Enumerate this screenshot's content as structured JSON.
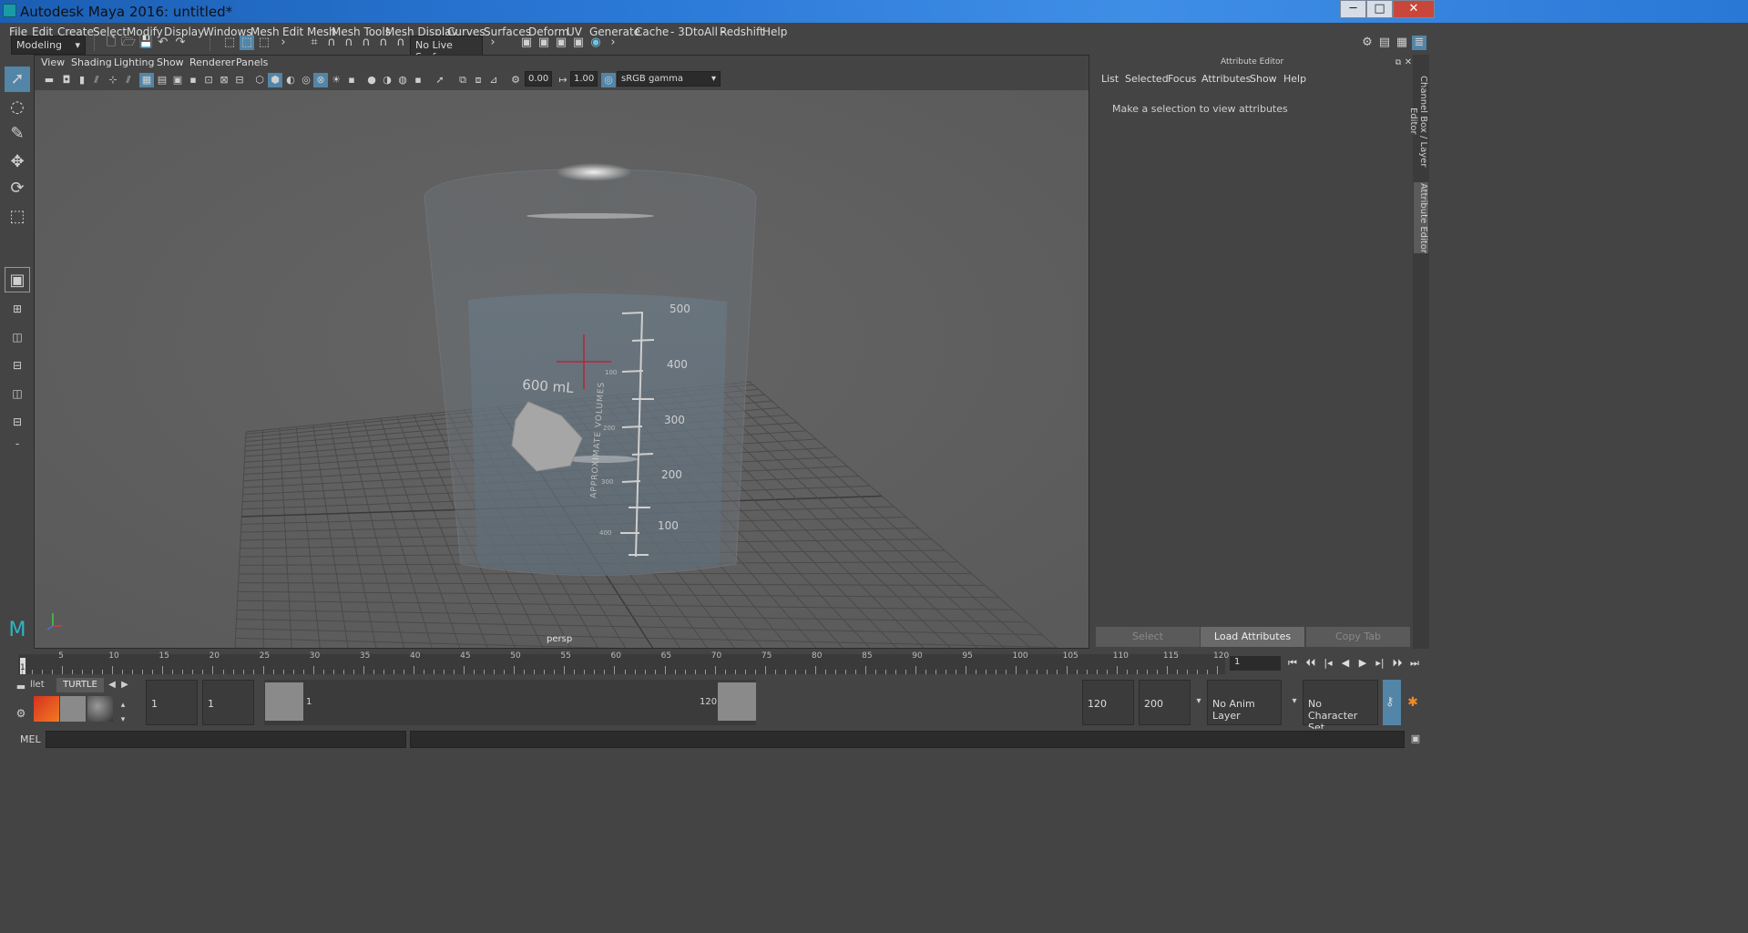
{
  "window": {
    "title": "Autodesk Maya 2016: untitled*",
    "minimize": "─",
    "maximize": "□",
    "close": "✕"
  },
  "menu": [
    "File",
    "Edit",
    "Create",
    "Select",
    "Modify",
    "Display",
    "Windows",
    "Mesh",
    "Edit Mesh",
    "Mesh Tools",
    "Mesh Display",
    "Curves",
    "Surfaces",
    "Deform",
    "UV",
    "Generate",
    "Cache",
    "- 3DtoAll -",
    "Redshift",
    "Help"
  ],
  "shelf": {
    "mode": "Modeling",
    "live_surface": "No Live Surface"
  },
  "viewport": {
    "menu": [
      "View",
      "Shading",
      "Lighting",
      "Show",
      "Renderer",
      "Panels"
    ],
    "exposure": "0.00",
    "gamma": "1.00",
    "color_space": "sRGB gamma",
    "camera_label": "persp",
    "beaker": {
      "capacity": "600 mL",
      "side_text": "APPROXIMATE VOLUMES",
      "marks_big": [
        "500",
        "400",
        "300",
        "200",
        "100"
      ],
      "marks_small": [
        "100",
        "200",
        "300",
        "400"
      ]
    }
  },
  "attribute_editor": {
    "title": "Attribute Editor",
    "menu": [
      "List",
      "Selected",
      "Focus",
      "Attributes",
      "Show",
      "Help"
    ],
    "message": "Make a selection to view attributes",
    "buttons": {
      "select": "Select",
      "load": "Load Attributes",
      "copy": "Copy Tab"
    }
  },
  "side_tabs": {
    "channel_box": "Channel Box / Layer Editor",
    "attribute_editor": "Attribute Editor"
  },
  "timeline": {
    "labels": [
      "5",
      "10",
      "15",
      "20",
      "25",
      "30",
      "35",
      "40",
      "45",
      "50",
      "55",
      "60",
      "65",
      "70",
      "75",
      "80",
      "85",
      "90",
      "95",
      "100",
      "105",
      "110",
      "115",
      "120"
    ],
    "start_marker": "1",
    "current_frame": "1",
    "playback": [
      "⏮",
      "⏴⏴",
      "|◂",
      "◀",
      "▶",
      "▸|",
      "⏵⏵",
      "⏭"
    ]
  },
  "range": {
    "tab_partial": "llet",
    "tab_turtle": "TURTLE",
    "start": "1",
    "playback_start": "1",
    "slider_start": "1",
    "slider_end": "120",
    "playback_end": "120",
    "end": "200",
    "anim_layer": "No Anim Layer",
    "character_set": "No Character Set"
  },
  "command_line": {
    "label": "MEL"
  }
}
